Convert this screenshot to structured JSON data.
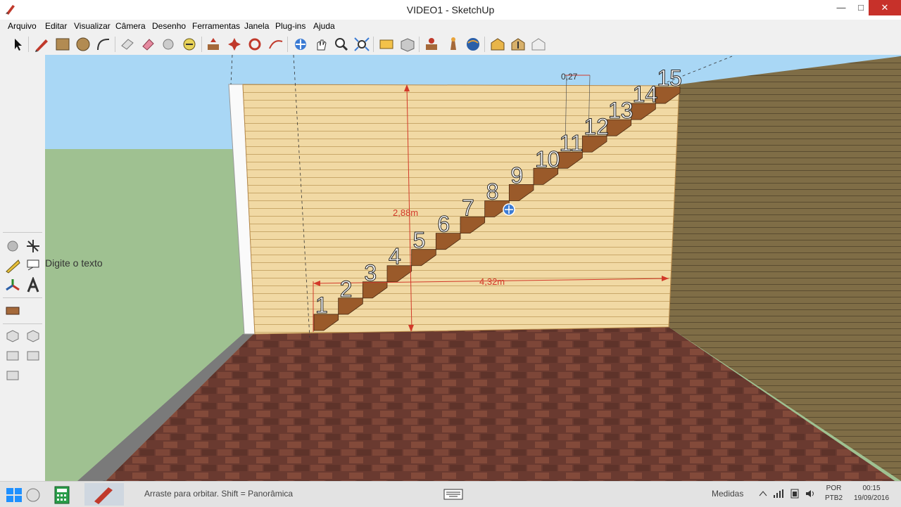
{
  "window": {
    "title": "VIDEO1 - SketchUp",
    "minimize": "—",
    "maximize": "□",
    "close": "✕"
  },
  "menu": [
    "Arquivo",
    "Editar",
    "Visualizar",
    "Câmera",
    "Desenho",
    "Ferramentas",
    "Janela",
    "Plug-ins",
    "Ajuda"
  ],
  "toolbar": {
    "icons": [
      "select-icon",
      "pencil-icon",
      "rectangle-icon",
      "circle-icon",
      "arc-icon",
      "eraser-icon",
      "paint-bucket-icon",
      "tape-icon",
      "push-pull-icon",
      "move-icon",
      "rotate-icon",
      "follow-me-icon",
      "offset-icon",
      "orbit-icon",
      "pan-icon",
      "zoom-icon",
      "zoom-extents-icon",
      "section-icon",
      "components-icon",
      "walk-icon",
      "look-around-icon",
      "position-camera-icon",
      "warehouse-icon",
      "share-model-icon",
      "extension-icon"
    ]
  },
  "left_panel": {
    "text_tool_label": "Digite o texto",
    "icons": [
      "tape-measure-icon",
      "axes-icon",
      "protractor-icon",
      "text-icon",
      "3d-axes-icon",
      "3d-text-icon",
      "sandbox-icon",
      "view-iso-icon",
      "view-top-icon",
      "view-front-icon",
      "view-right-icon",
      "view-back-icon"
    ]
  },
  "scene": {
    "height_dim": "2,88m",
    "width_dim": "4,32m",
    "step_dim": "0,27",
    "step_labels": [
      "1",
      "2",
      "3",
      "4",
      "5",
      "6",
      "7",
      "8",
      "9",
      "10",
      "11",
      "12",
      "13",
      "14",
      "15"
    ],
    "colors": {
      "sky": "#a9d7f5",
      "ground": "#9fc191",
      "wall": "#f1d9a4",
      "floor": "#6a3a30",
      "stair": "#9a5a2a",
      "dim": "#d23a2a"
    }
  },
  "status_bar": {
    "hint": "Arraste para orbitar. Shift = Panorâmica",
    "measures_label": "Medidas",
    "language": "POR",
    "keyboard": "PTB2",
    "time": "00:15",
    "date": "19/09/2016"
  }
}
